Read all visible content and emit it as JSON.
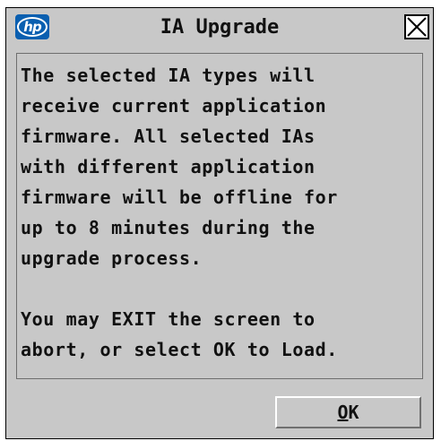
{
  "dialog": {
    "title": "IA Upgrade",
    "logo_text": "hp",
    "close_icon": "close-icon"
  },
  "message": {
    "lines": [
      "The selected IA types will",
      "receive current application",
      "firmware. All selected IAs",
      "with different application",
      "firmware will be offline for",
      "up to 8 minutes during the",
      "upgrade process.",
      "",
      "You may EXIT the screen to",
      "abort, or select OK to Load."
    ]
  },
  "buttons": {
    "ok_mnemonic": "O",
    "ok_rest": "K"
  }
}
